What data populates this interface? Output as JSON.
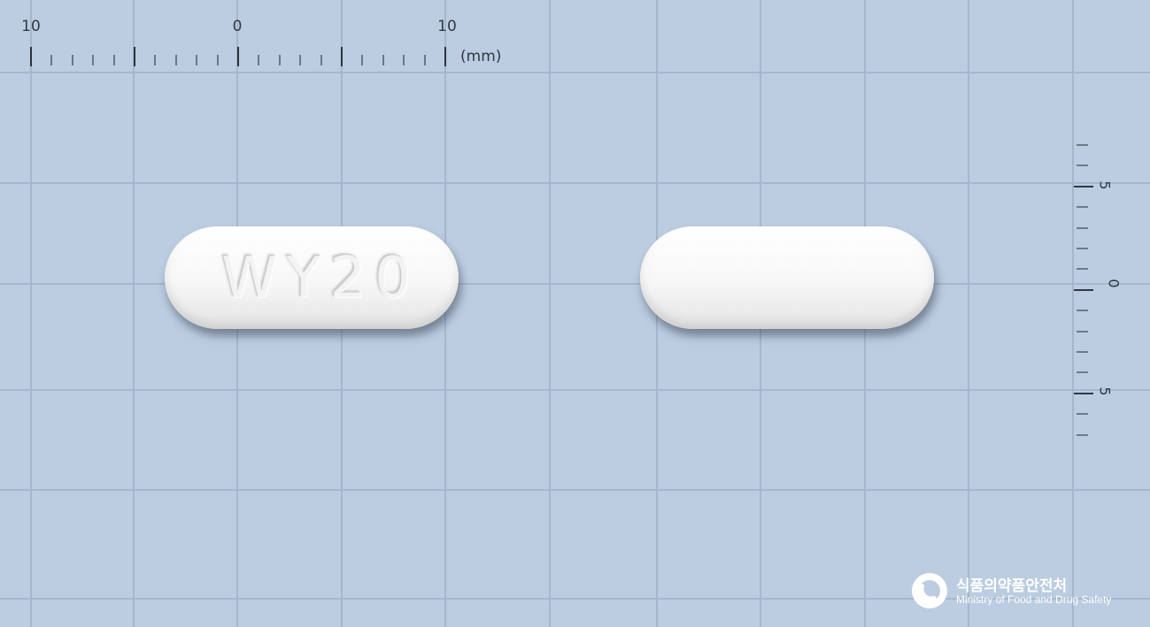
{
  "ruler_top": {
    "labels": [
      "10",
      "0",
      "10"
    ],
    "unit": "(mm)"
  },
  "ruler_side": {
    "labels": [
      "5",
      "0",
      "5"
    ]
  },
  "tablet_front": {
    "imprint": "WY20",
    "color": "#ffffff"
  },
  "tablet_back": {
    "imprint": "",
    "color": "#ffffff"
  },
  "logo": {
    "korean": "식품의약품안전처",
    "english": "Ministry of Food and Drug Safety"
  },
  "colors": {
    "background": "#bccde1",
    "grid": "#a5b7cc"
  }
}
